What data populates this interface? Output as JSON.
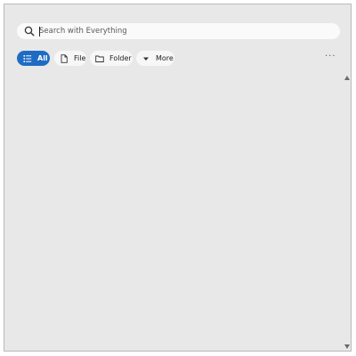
{
  "search": {
    "placeholder": "Search with Everything",
    "value": ""
  },
  "filters": [
    {
      "label": "All",
      "icon": "list-icon",
      "active": true
    },
    {
      "label": "File",
      "icon": "file-icon",
      "active": false
    },
    {
      "label": "Folder",
      "icon": "folder-icon",
      "active": false
    },
    {
      "label": "More",
      "icon": "caret-down-icon",
      "active": false
    }
  ],
  "more_options": {
    "label": "···"
  },
  "colors": {
    "accent": "#1f6bc4",
    "background": "#e8e8e8",
    "chip_background": "#f7f7f7"
  }
}
